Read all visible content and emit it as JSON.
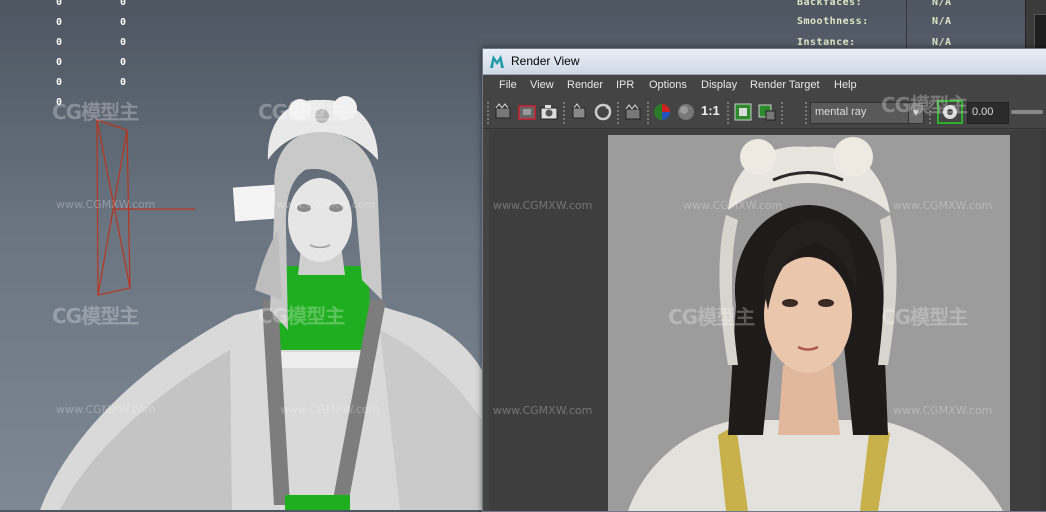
{
  "hud_left": {
    "col_a": [
      "0",
      "0",
      "0",
      "0",
      "0",
      "0"
    ],
    "col_b": [
      "0",
      "0",
      "0",
      "0",
      "0"
    ]
  },
  "hud_right": {
    "rows": [
      {
        "label": "Backfaces:",
        "value": "N/A"
      },
      {
        "label": "Smoothness:",
        "value": "N/A"
      },
      {
        "label": "Instance:",
        "value": "N/A"
      }
    ]
  },
  "watermarks": {
    "brand_latin": "CG",
    "brand_cjk": "模型主",
    "url": "www.CGMXW.com"
  },
  "render_view": {
    "title": "Render View",
    "menu": [
      "File",
      "View",
      "Render",
      "IPR",
      "Options",
      "Display",
      "Render Target",
      "Help"
    ],
    "renderer": "mental ray",
    "ratio_label": "1:1",
    "exposure": "0.00"
  },
  "colors": {
    "accent_green": "#1fae1f",
    "render_bg": "#9c9c9c",
    "window_frame": "#444444",
    "titlebar": "#d9e2ee"
  }
}
